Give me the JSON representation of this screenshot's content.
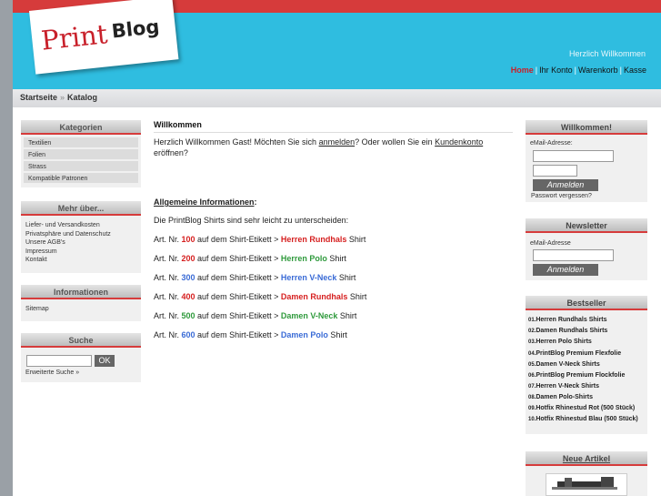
{
  "header": {
    "logo_print": "Print",
    "logo_blog": "Blog",
    "welcome": "Herzlich Willkommen",
    "nav": [
      {
        "label": "Home",
        "active": true
      },
      {
        "label": "Ihr Konto",
        "active": false
      },
      {
        "label": "Warenkorb",
        "active": false
      },
      {
        "label": "Kasse",
        "active": false
      }
    ]
  },
  "breadcrumb": {
    "first": "Startseite",
    "sep": "»",
    "second": "Katalog"
  },
  "left": {
    "categories": {
      "title": "Kategorien",
      "items": [
        "Textilien",
        "Folien",
        "Strass",
        "Kompatible Patronen"
      ]
    },
    "more": {
      "title": "Mehr über...",
      "items": [
        "Liefer- und Versandkosten",
        "Privatsphäre und Datenschutz",
        "Unsere AGB's",
        "Impressum",
        "Kontakt"
      ]
    },
    "info": {
      "title": "Informationen",
      "items": [
        "Sitemap"
      ]
    },
    "search": {
      "title": "Suche",
      "button": "OK",
      "advanced": "Erweiterte Suche »"
    }
  },
  "content": {
    "title": "Willkommen",
    "intro_a": "Herzlich Willkommen Gast! Möchten Sie sich ",
    "intro_login": "anmelden",
    "intro_b": "? Oder wollen Sie ein ",
    "intro_account": "Kundenkonto",
    "intro_c": " eröffnen?",
    "info_title": "Allgemeine Informationen",
    "info_colon": ":",
    "info_text": "Die PrintBlog Shirts sind sehr leicht zu unterscheiden:",
    "lines": [
      {
        "pre": "Art. Nr. ",
        "num": "100",
        "mid": " auf dem Shirt-Etikett > ",
        "prod": "Herren Rundhals",
        "post": " Shirt"
      },
      {
        "pre": "Art. Nr. ",
        "num": "200",
        "mid": " auf dem Shirt-Etikett > ",
        "prod": "Herren Polo",
        "post": " Shirt"
      },
      {
        "pre": "Art. Nr. ",
        "num": "300",
        "mid": " auf dem Shirt-Etikett > ",
        "prod": "Herren V-Neck",
        "post": " Shirt"
      },
      {
        "pre": "Art. Nr. ",
        "num": "400",
        "mid": " auf dem Shirt-Etikett > ",
        "prod": "Damen Rundhals",
        "post": " Shirt"
      },
      {
        "pre": "Art. Nr. ",
        "num": "500",
        "mid": " auf dem Shirt-Etikett > ",
        "prod": "Damen V-Neck",
        "post": " Shirt"
      },
      {
        "pre": "Art. Nr. ",
        "num": "600",
        "mid": " auf dem Shirt-Etikett > ",
        "prod": "Damen Polo",
        "post": " Shirt"
      }
    ]
  },
  "right": {
    "login": {
      "title": "Willkommen!",
      "email_label": "eMail-Adresse:",
      "button": "Anmelden",
      "forgot": "Passwort vergessen?"
    },
    "newsletter": {
      "title": "Newsletter",
      "email_label": "eMail-Adresse",
      "button": "Anmelden"
    },
    "bestseller": {
      "title": "Bestseller",
      "items": [
        {
          "n": "01.",
          "t": "Herren Rundhals Shirts"
        },
        {
          "n": "02.",
          "t": "Damen Rundhals Shirts"
        },
        {
          "n": "03.",
          "t": "Herren Polo Shirts"
        },
        {
          "n": "04.",
          "t": "PrintBlog Premium Flexfolie"
        },
        {
          "n": "05.",
          "t": "Damen V-Neck Shirts"
        },
        {
          "n": "06.",
          "t": "PrintBlog Premium Flockfolie"
        },
        {
          "n": "07.",
          "t": "Herren V-Neck Shirts"
        },
        {
          "n": "08.",
          "t": "Damen Polo-Shirts"
        },
        {
          "n": "09.",
          "t": "Hotfix Rhinestud Rot (500 Stück)"
        },
        {
          "n": "10.",
          "t": "Hotfix Rhinestud Blau (500 Stück)"
        }
      ]
    },
    "new": {
      "title": "Neue Artikel"
    }
  },
  "colors": {
    "accent_red": "#d63b3b",
    "header_blue": "#2fbde0",
    "green": "#2f9a3c",
    "blue": "#3a6bd6"
  }
}
